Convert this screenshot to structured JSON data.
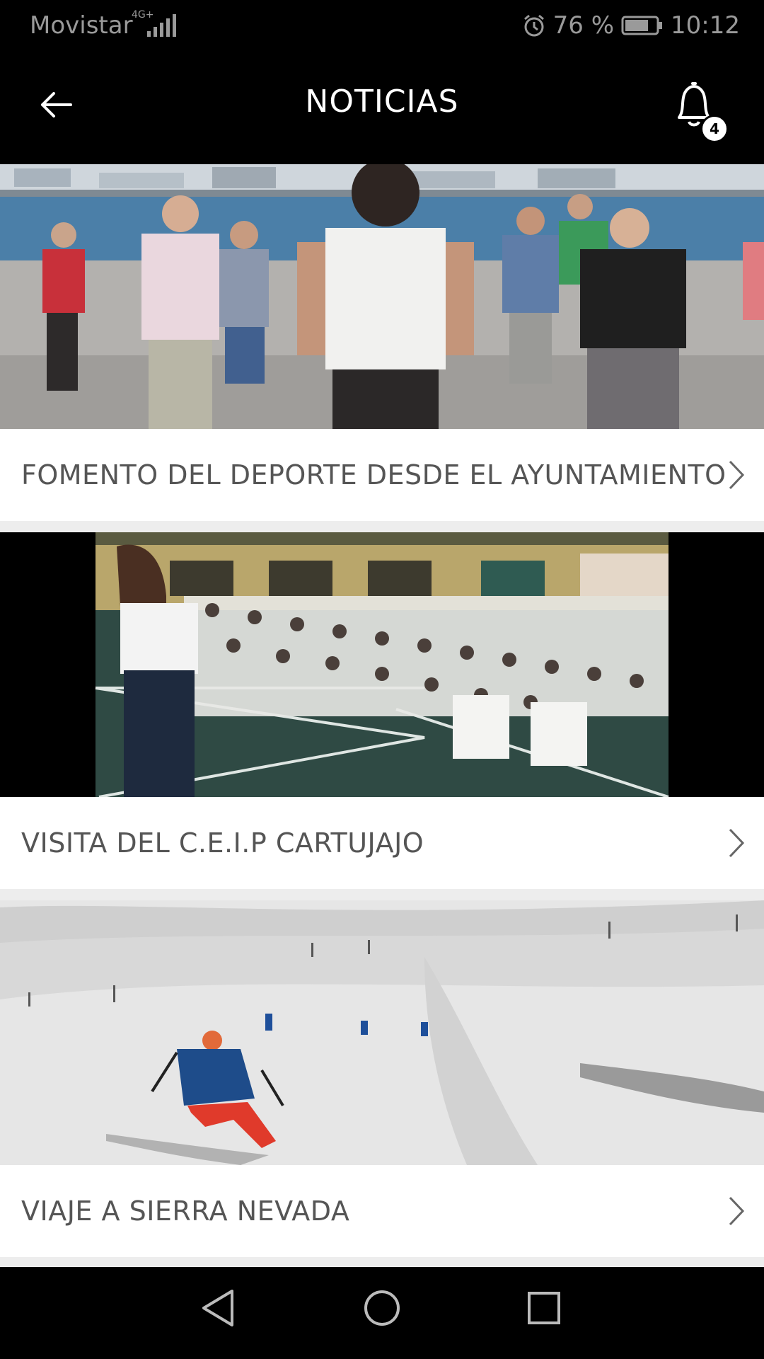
{
  "status_bar": {
    "carrier": "Movistar",
    "network": "4G+",
    "battery": "76 %",
    "time": "10:12",
    "icons": [
      "signal-icon",
      "alarm-icon",
      "battery-icon"
    ]
  },
  "header": {
    "title": "NOTICIAS",
    "notification_count": "4",
    "icons": [
      "back-arrow-icon",
      "bell-icon"
    ]
  },
  "news": [
    {
      "title": "FOMENTO DEL DEPORTE DESDE EL AYUNTAMIENTO",
      "image": "outdoor exercise class by the sea"
    },
    {
      "title": "VISITA DEL C.E.I.P CARTUJAJO",
      "image": "students seated on a sports court"
    },
    {
      "title": "VIAJE A SIERRA NEVADA",
      "image": "skier on a snowy slope"
    }
  ],
  "nav": {
    "icons": [
      "back-triangle-icon",
      "home-circle-icon",
      "recents-square-icon"
    ]
  },
  "colors": {
    "bar": "#000000",
    "text": "#555555",
    "separator": "#ededed"
  }
}
